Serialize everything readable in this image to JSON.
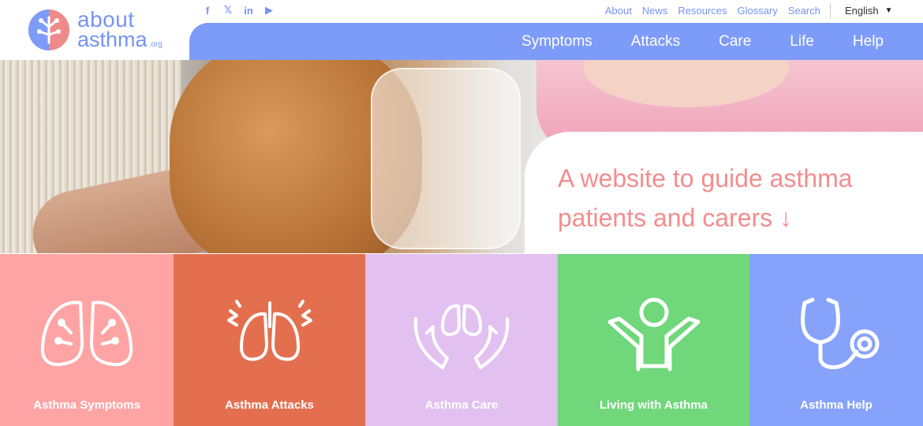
{
  "logo": {
    "line1": "about",
    "line2": "asthma",
    "suffix": ".org"
  },
  "social": [
    {
      "icon": "facebook-icon",
      "glyph": "f"
    },
    {
      "icon": "x-icon",
      "glyph": "𝕏"
    },
    {
      "icon": "linkedin-icon",
      "glyph": "in"
    },
    {
      "icon": "youtube-icon",
      "glyph": "▶"
    }
  ],
  "topnav": [
    "About",
    "News",
    "Resources",
    "Glossary",
    "Search"
  ],
  "language": {
    "selected": "English",
    "caret": "▼"
  },
  "mainnav": [
    "Symptoms",
    "Attacks",
    "Care",
    "Life",
    "Help"
  ],
  "hero": {
    "title": "A website to guide asthma patients and carers",
    "arrow": "↓"
  },
  "tiles": [
    {
      "label": "Asthma Symptoms",
      "icon": "lungs-icon",
      "color": "#ffa4a4"
    },
    {
      "label": "Asthma Attacks",
      "icon": "lungs-alert-icon",
      "color": "#e46f4e"
    },
    {
      "label": "Asthma Care",
      "icon": "hands-lungs-icon",
      "color": "#e2c1f1"
    },
    {
      "label": "Living with Asthma",
      "icon": "person-arms-up-icon",
      "color": "#70d77b"
    },
    {
      "label": "Asthma Help",
      "icon": "stethoscope-icon",
      "color": "#87a2fb"
    }
  ],
  "colors": {
    "brand": "#7d9bf8",
    "accent": "#f48d8e"
  }
}
